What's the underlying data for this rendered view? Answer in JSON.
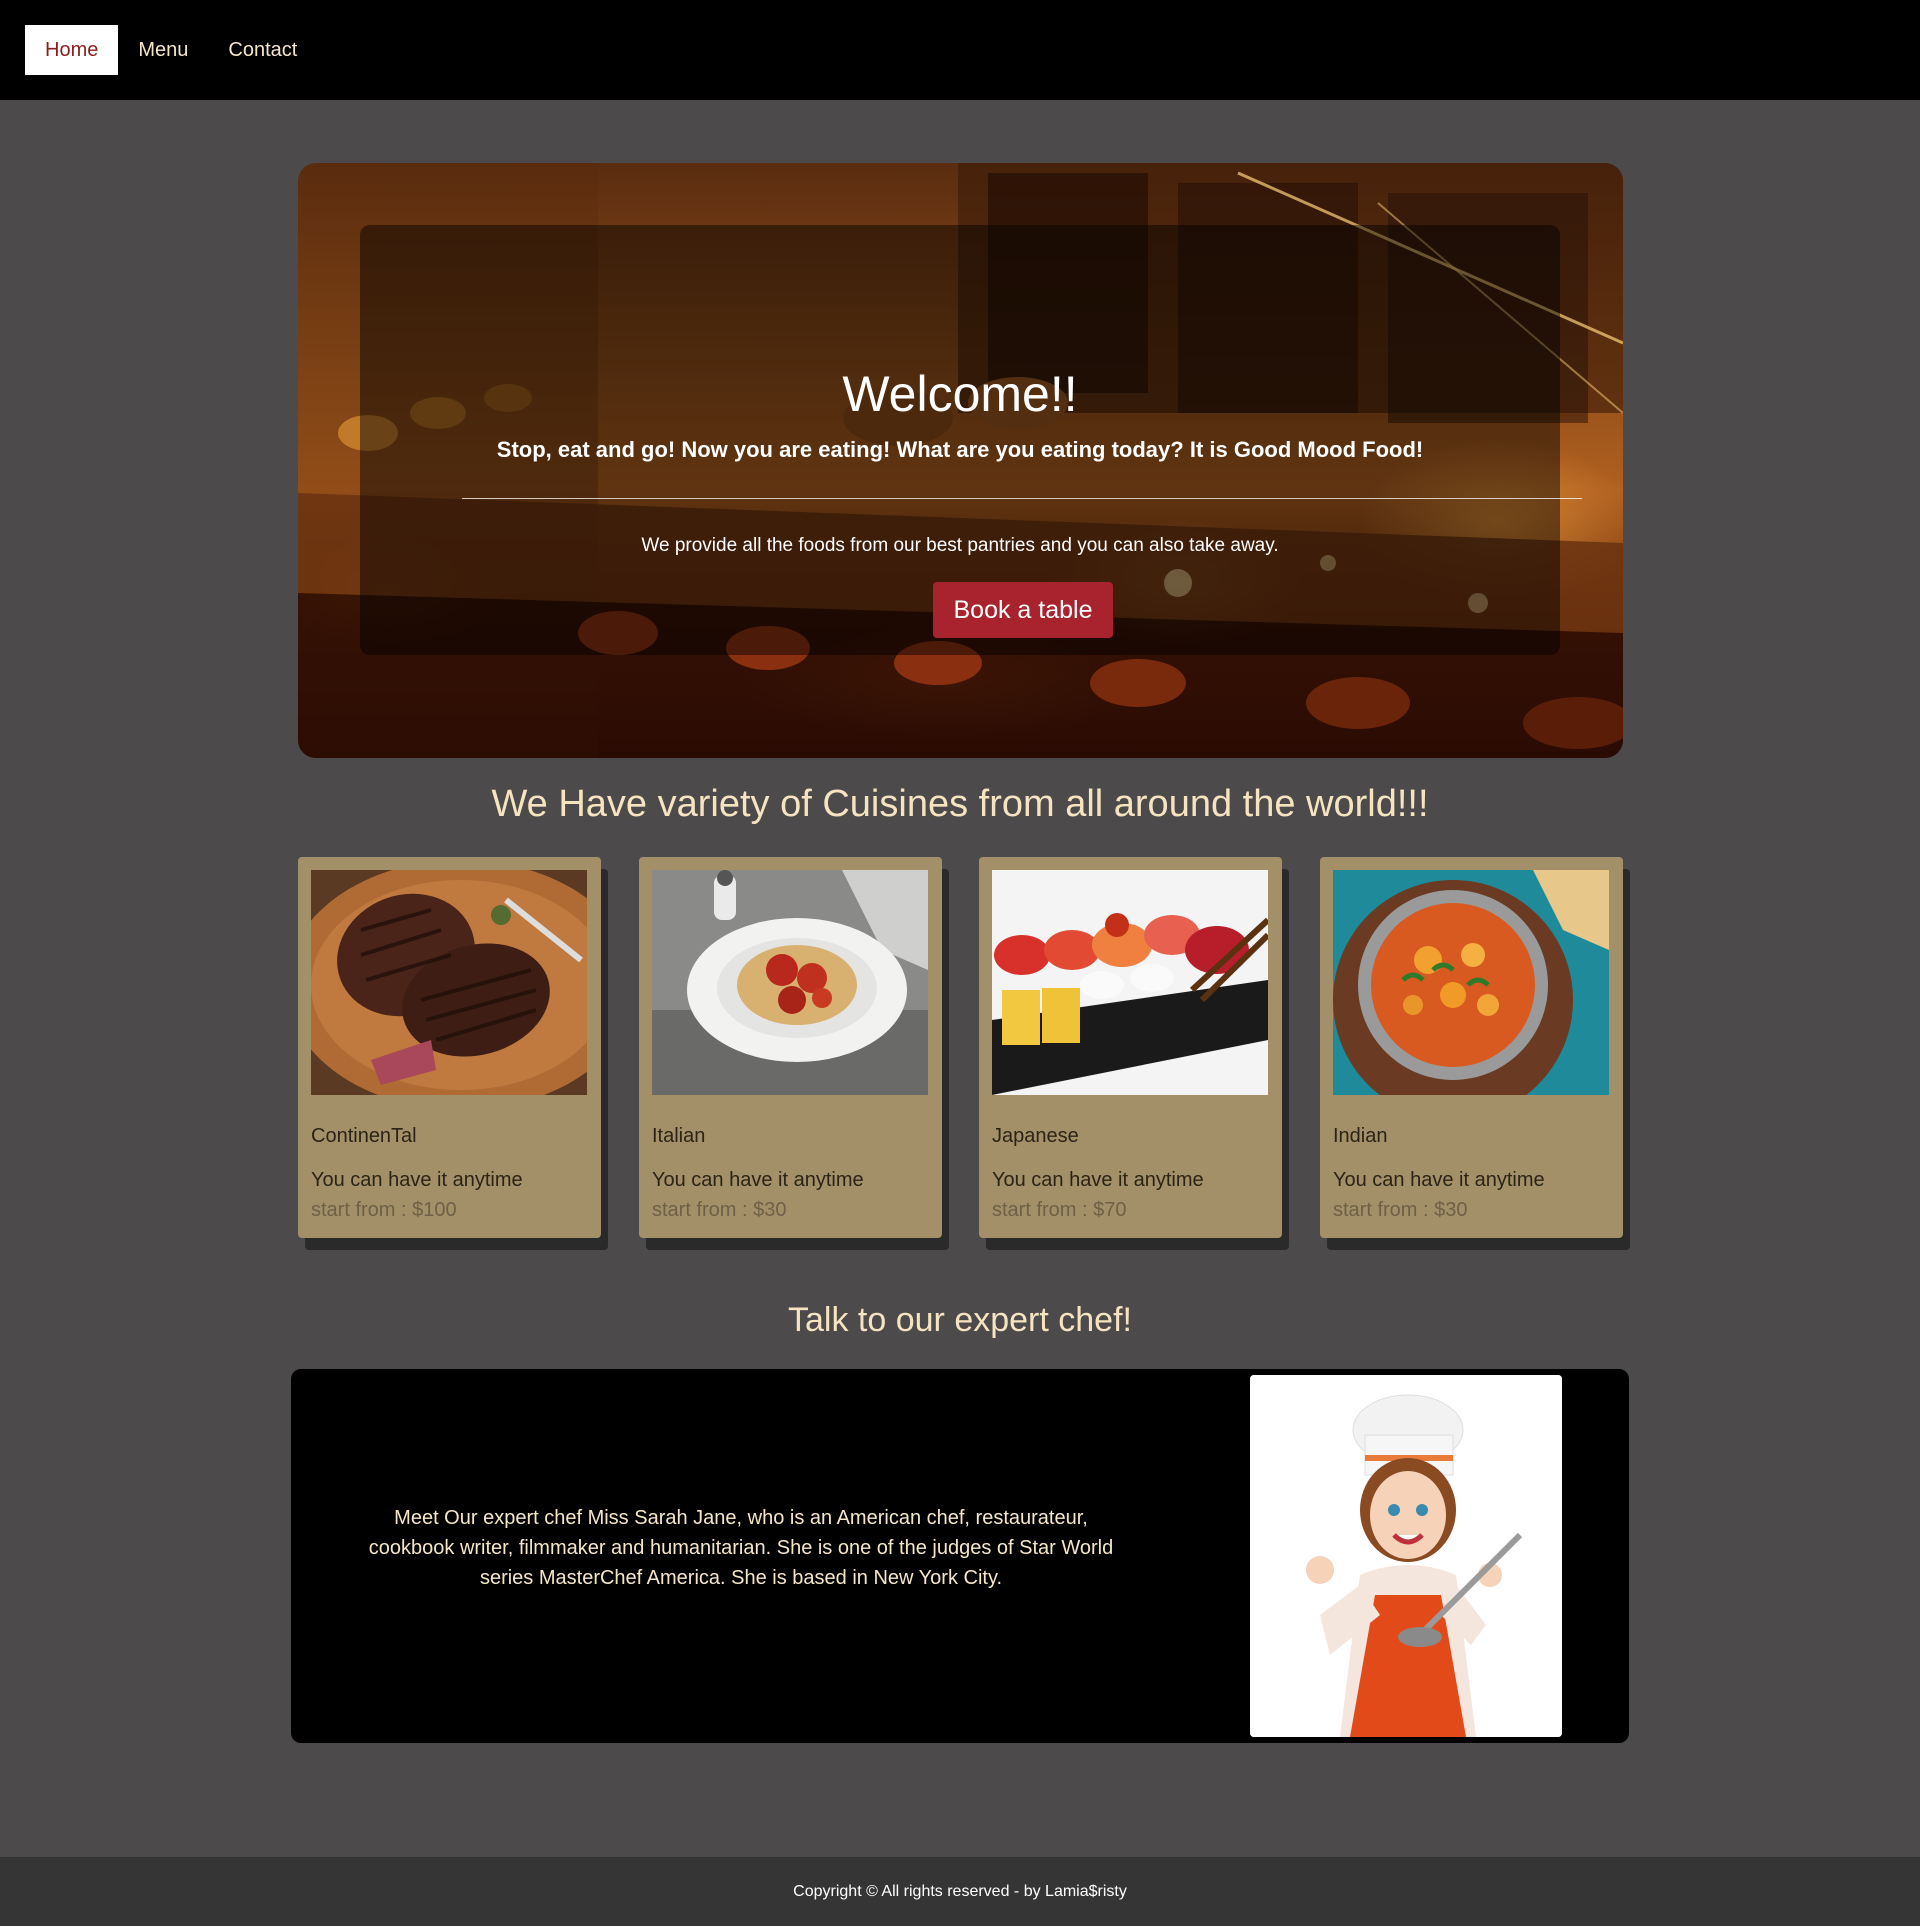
{
  "nav": {
    "items": [
      {
        "label": "Home",
        "active": true
      },
      {
        "label": "Menu",
        "active": false
      },
      {
        "label": "Contact",
        "active": false
      }
    ]
  },
  "hero": {
    "title": "Welcome!!",
    "subtitle": "Stop, eat and go! Now you are eating! What are you eating today? It is Good Mood Food!",
    "description": "We provide all the foods from our best pantries and you can also take away.",
    "button_label": "Book a table"
  },
  "cuisines": {
    "title": "We Have variety of Cuisines from all around the world!!!",
    "cards": [
      {
        "name": "ContinenTal",
        "line": "You can have it anytime",
        "price": "start from : $100",
        "image": "steak-image"
      },
      {
        "name": "Italian",
        "line": "You can have it anytime",
        "price": "start from : $30",
        "image": "spaghetti-image"
      },
      {
        "name": "Japanese",
        "line": "You can have it anytime",
        "price": "start from : $70",
        "image": "sushi-image"
      },
      {
        "name": "Indian",
        "line": "You can have it anytime",
        "price": "start from : $30",
        "image": "curry-image"
      }
    ]
  },
  "chef": {
    "title": "Talk to our expert chef!",
    "description": "Meet Our expert chef Miss Sarah Jane, who is an American chef, restaurateur, cookbook writer, filmmaker and humanitarian. She is one of the judges of Star World series MasterChef America. She is based in New York City.",
    "image": "chef-illustration"
  },
  "footer": {
    "text": "Copyright © All rights reserved - by Lamia$risty"
  },
  "colors": {
    "nav_bg": "#000000",
    "page_bg": "#4c4a4b",
    "accent_button": "#a8232d",
    "card_bg": "#a39068",
    "heading": "#f6e3c0",
    "footer_bg": "#353535"
  }
}
